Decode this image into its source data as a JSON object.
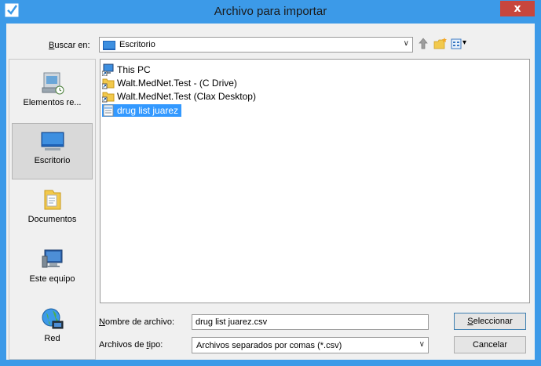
{
  "window": {
    "title": "Archivo para importar",
    "close_label": "x"
  },
  "toolbar": {
    "lookin_label_pre": "",
    "lookin_label_key": "B",
    "lookin_label_post": "uscar en:",
    "lookin_value": "Escritorio",
    "dropdown_arrow": "∨",
    "view_menu_arrow": "▾"
  },
  "places": [
    {
      "label": "Elementos re...",
      "icon": "recent-items-icon"
    },
    {
      "label": "Escritorio",
      "icon": "desktop-icon",
      "selected": true
    },
    {
      "label": "Documentos",
      "icon": "documents-folder-icon"
    },
    {
      "label": "Este equipo",
      "icon": "computer-icon"
    },
    {
      "label": "Red",
      "icon": "network-globe-icon"
    }
  ],
  "files": [
    {
      "name": "This PC",
      "icon": "pc-shortcut-icon"
    },
    {
      "name": "Walt.MedNet.Test - (C Drive)",
      "icon": "folder-shortcut-icon"
    },
    {
      "name": "Walt.MedNet.Test (Clax Desktop)",
      "icon": "folder-shortcut-icon"
    },
    {
      "name": "drug list juarez",
      "icon": "csv-file-icon",
      "selected": true
    }
  ],
  "form": {
    "filename_label_key": "N",
    "filename_label_post": "ombre de archivo:",
    "filename_value": "drug list juarez.csv",
    "filetype_label_pre": "Archivos de ",
    "filetype_label_key": "t",
    "filetype_label_post": "ipo:",
    "filetype_value": "Archivos separados por comas (*.csv)",
    "dropdown_arrow": "∨"
  },
  "buttons": {
    "select_key": "S",
    "select_post": "eleccionar",
    "cancel": "Cancelar"
  },
  "colors": {
    "titlebar": "#3c9ae8",
    "close": "#c7463d",
    "selection": "#3399ff"
  }
}
